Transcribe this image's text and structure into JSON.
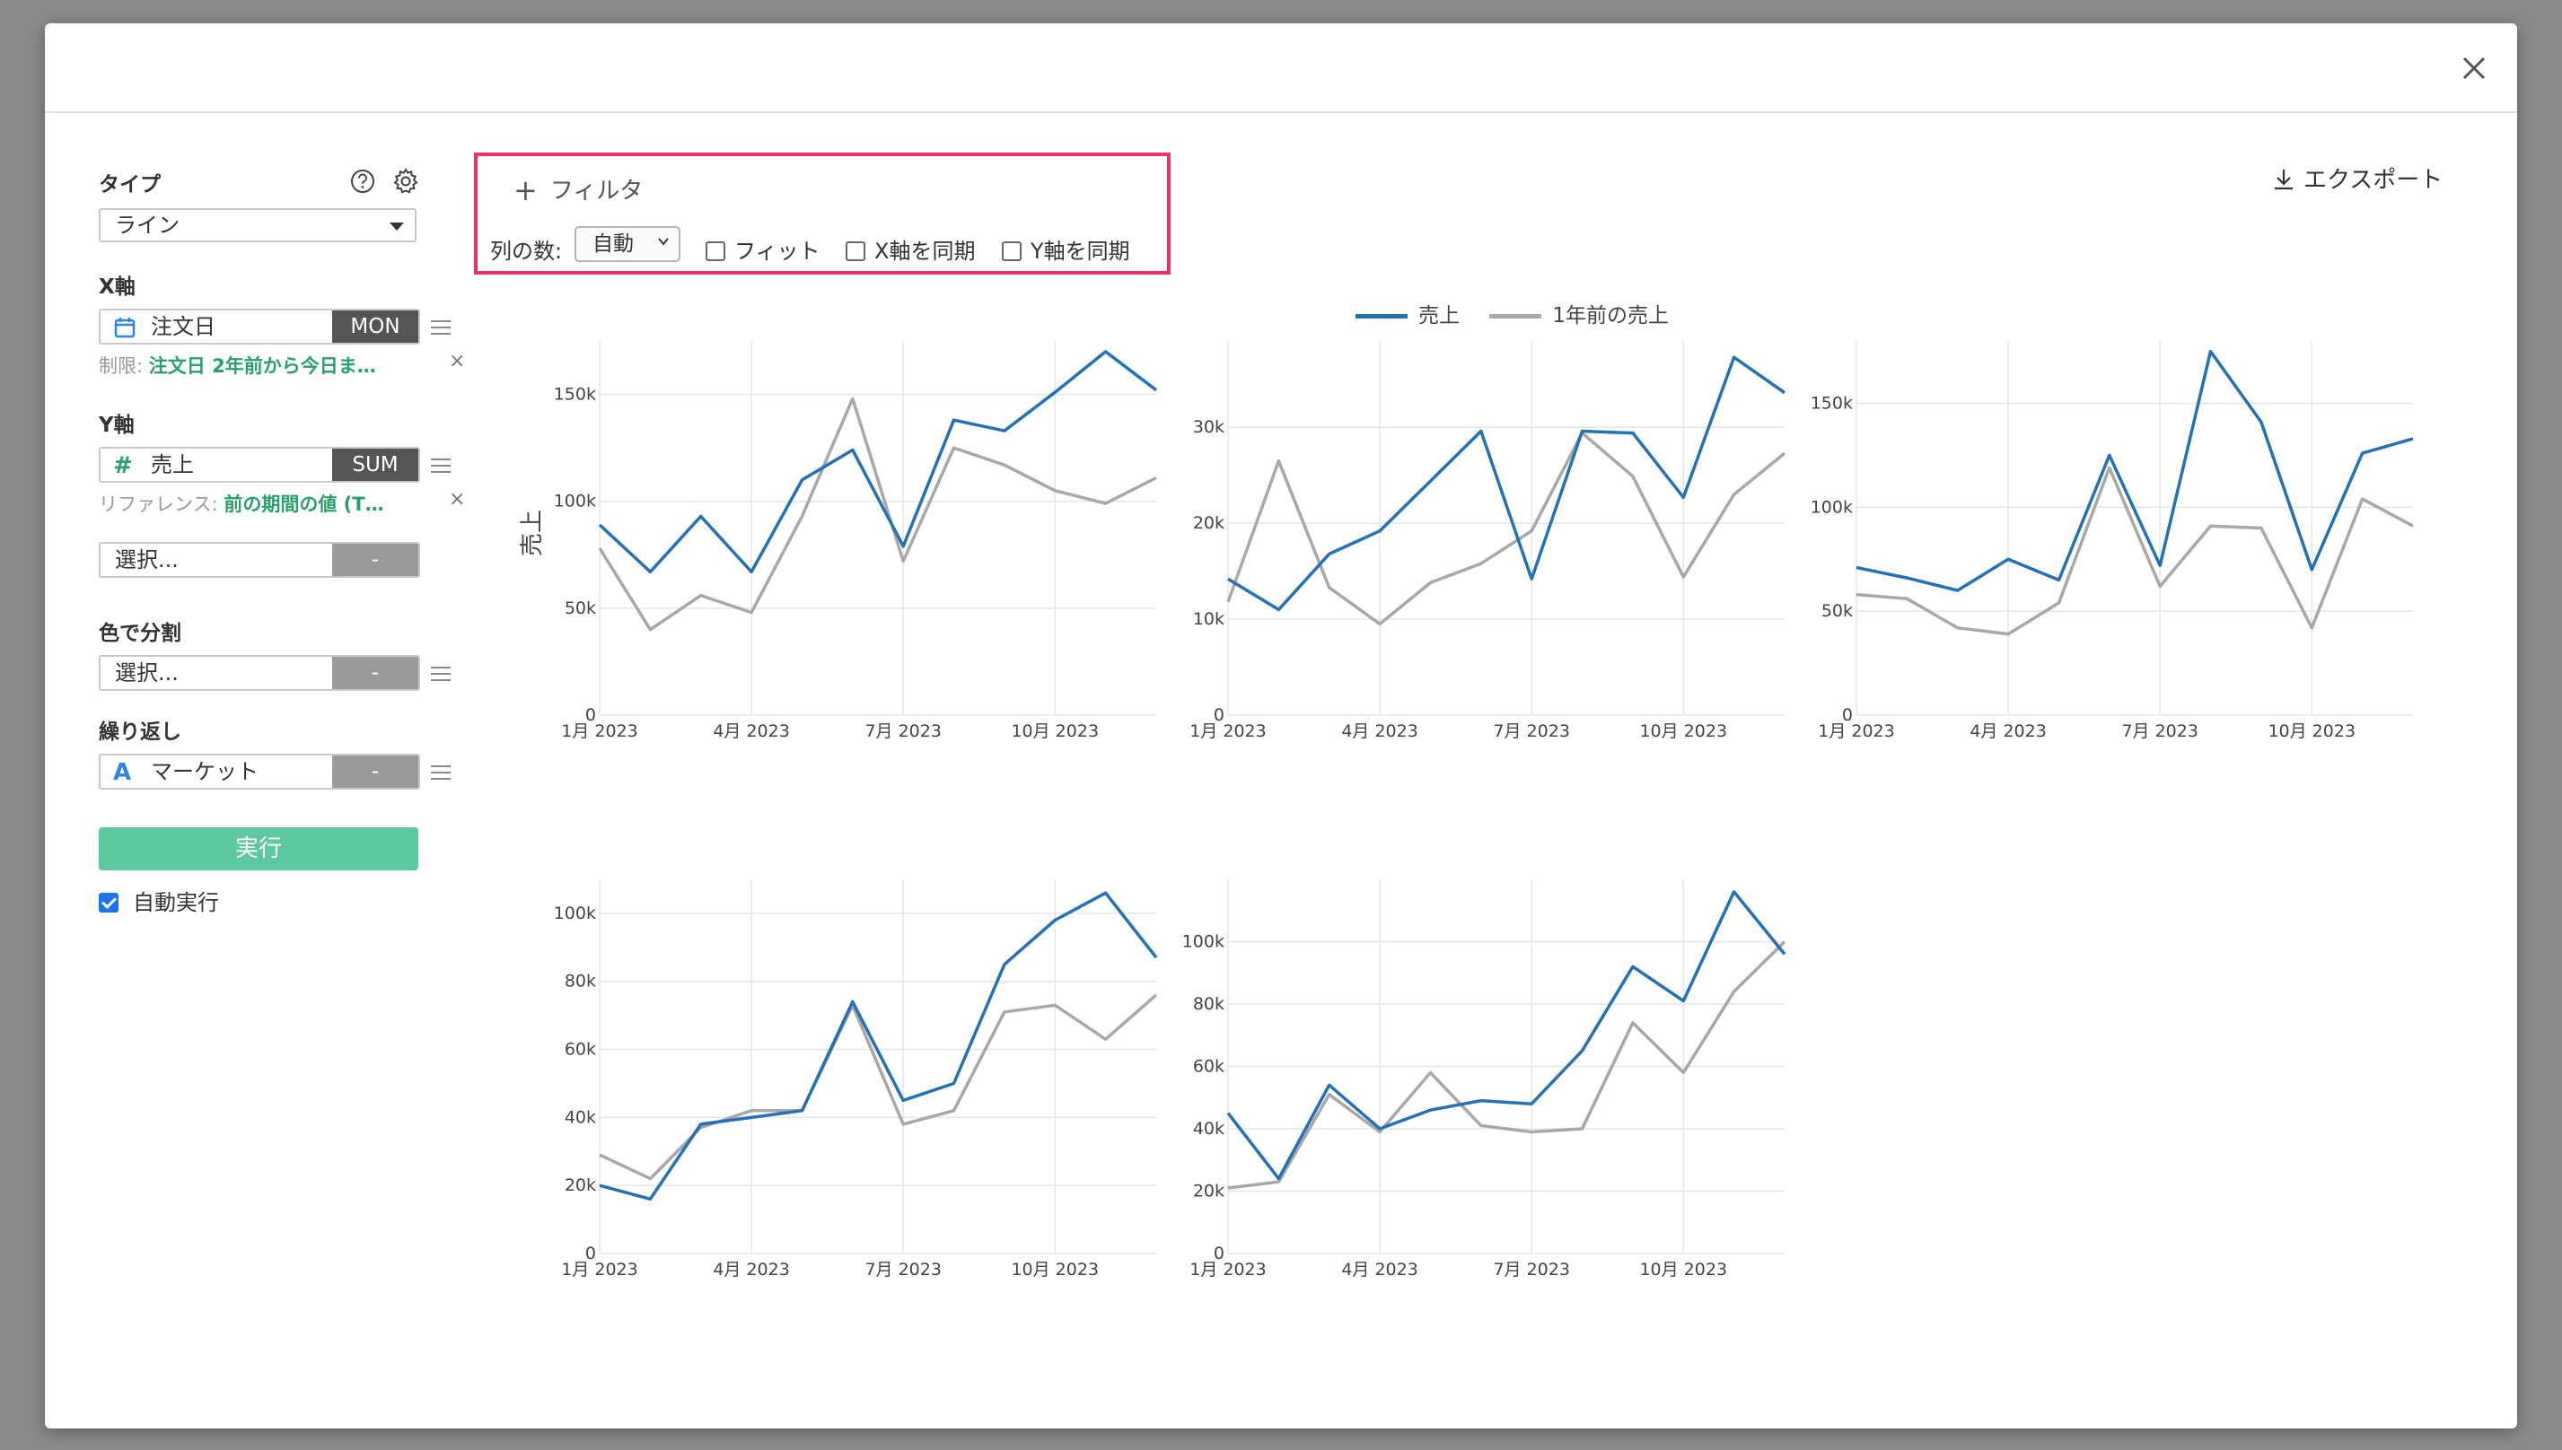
{
  "sidebar": {
    "type_label": "タイプ",
    "type_value": "ライン",
    "x_axis_label": "X軸",
    "x_field": "注文日",
    "x_tag": "MON",
    "x_limit_prefix": "制限:",
    "x_limit_value": "注文日 2年前から今日ま…",
    "y_axis_label": "Y軸",
    "y_field": "売上",
    "y_tag": "SUM",
    "y_ref_prefix": "リファレンス:",
    "y_ref_value": "前の期間の値 (T…",
    "extra_placeholder": "選択...",
    "extra_tag": "-",
    "color_label": "色で分割",
    "color_placeholder": "選択...",
    "color_tag": "-",
    "repeat_label": "繰り返し",
    "repeat_field": "マーケット",
    "repeat_tag": "-",
    "run_label": "実行",
    "auto_run_label": "自動実行",
    "remove_symbol": "×"
  },
  "filter": {
    "add_label": "フィルタ",
    "columns_label": "列の数:",
    "columns_value": "自動",
    "fit_label": "フィット",
    "sync_x_label": "X軸を同期",
    "sync_y_label": "Y軸を同期"
  },
  "export_label": "エクスポート",
  "legend": {
    "series1": "売上",
    "series2": "1年前の売上"
  },
  "y_title": "売上",
  "colors": {
    "series1": "#2471b5",
    "series2": "#a8a8a8",
    "accent": "#e8336d",
    "run": "#5ec8a0"
  },
  "chart_data": [
    {
      "type": "line",
      "x": [
        "1月 2023",
        "2月 2023",
        "3月 2023",
        "4月 2023",
        "5月 2023",
        "6月 2023",
        "7月 2023",
        "8月 2023",
        "9月 2023",
        "10月 2023",
        "11月 2023",
        "12月 2023"
      ],
      "x_tick_labels": [
        "1月 2023",
        "4月 2023",
        "7月 2023",
        "10月 2023"
      ],
      "y_ticks": [
        0,
        50000,
        100000,
        150000
      ],
      "y_tick_labels": [
        "0",
        "50k",
        "100k",
        "150k"
      ],
      "ylim": [
        0,
        175000
      ],
      "ylabel": "売上",
      "series": [
        {
          "name": "売上",
          "values": [
            89000,
            67000,
            93000,
            67000,
            110000,
            124000,
            79000,
            138000,
            133000,
            151000,
            170000,
            152000
          ]
        },
        {
          "name": "1年前の売上",
          "values": [
            78000,
            40000,
            56000,
            48000,
            93000,
            148000,
            72000,
            125000,
            117000,
            105000,
            99000,
            111000
          ]
        }
      ]
    },
    {
      "type": "line",
      "x": [
        "1月 2023",
        "2月 2023",
        "3月 2023",
        "4月 2023",
        "5月 2023",
        "6月 2023",
        "7月 2023",
        "8月 2023",
        "9月 2023",
        "10月 2023",
        "11月 2023",
        "12月 2023"
      ],
      "x_tick_labels": [
        "1月 2023",
        "4月 2023",
        "7月 2023",
        "10月 2023"
      ],
      "y_ticks": [
        0,
        10000,
        20000,
        30000
      ],
      "y_tick_labels": [
        "0",
        "10k",
        "20k",
        "30k"
      ],
      "ylim": [
        0,
        39000
      ],
      "series": [
        {
          "name": "売上",
          "values": [
            14200,
            11000,
            16800,
            19200,
            24400,
            29600,
            14200,
            29600,
            29400,
            22700,
            37300,
            33600
          ]
        },
        {
          "name": "1年前の売上",
          "values": [
            11800,
            26500,
            13300,
            9500,
            13800,
            15800,
            19200,
            29400,
            24900,
            14400,
            23000,
            27300
          ]
        }
      ]
    },
    {
      "type": "line",
      "x": [
        "1月 2023",
        "2月 2023",
        "3月 2023",
        "4月 2023",
        "5月 2023",
        "6月 2023",
        "7月 2023",
        "8月 2023",
        "9月 2023",
        "10月 2023",
        "11月 2023",
        "12月 2023"
      ],
      "x_tick_labels": [
        "1月 2023",
        "4月 2023",
        "7月 2023",
        "10月 2023"
      ],
      "y_ticks": [
        0,
        50000,
        100000,
        150000
      ],
      "y_tick_labels": [
        "0",
        "50k",
        "100k",
        "150k"
      ],
      "ylim": [
        0,
        180000
      ],
      "series": [
        {
          "name": "売上",
          "values": [
            71000,
            66000,
            60000,
            75000,
            65000,
            125000,
            72000,
            175000,
            141000,
            70000,
            126000,
            133000
          ]
        },
        {
          "name": "1年前の売上",
          "values": [
            58000,
            56000,
            42000,
            39000,
            54000,
            119000,
            62000,
            91000,
            90000,
            42000,
            104000,
            91000
          ]
        }
      ]
    },
    {
      "type": "line",
      "x": [
        "1月 2023",
        "2月 2023",
        "3月 2023",
        "4月 2023",
        "5月 2023",
        "6月 2023",
        "7月 2023",
        "8月 2023",
        "9月 2023",
        "10月 2023",
        "11月 2023",
        "12月 2023"
      ],
      "x_tick_labels": [
        "1月 2023",
        "4月 2023",
        "7月 2023",
        "10月 2023"
      ],
      "y_ticks": [
        0,
        20000,
        40000,
        60000,
        80000,
        100000
      ],
      "y_tick_labels": [
        "0",
        "20k",
        "40k",
        "60k",
        "80k",
        "100k"
      ],
      "ylim": [
        0,
        110000
      ],
      "series": [
        {
          "name": "売上",
          "values": [
            20000,
            16000,
            38000,
            40000,
            42000,
            74000,
            45000,
            50000,
            85000,
            98000,
            106000,
            87000
          ]
        },
        {
          "name": "1年前の売上",
          "values": [
            29000,
            22000,
            37000,
            42000,
            42000,
            73000,
            38000,
            42000,
            71000,
            73000,
            63000,
            76000
          ]
        }
      ]
    },
    {
      "type": "line",
      "x": [
        "1月 2023",
        "2月 2023",
        "3月 2023",
        "4月 2023",
        "5月 2023",
        "6月 2023",
        "7月 2023",
        "8月 2023",
        "9月 2023",
        "10月 2023",
        "11月 2023",
        "12月 2023"
      ],
      "x_tick_labels": [
        "1月 2023",
        "4月 2023",
        "7月 2023",
        "10月 2023"
      ],
      "y_ticks": [
        0,
        20000,
        40000,
        60000,
        80000,
        100000
      ],
      "y_tick_labels": [
        "0",
        "20k",
        "40k",
        "60k",
        "80k",
        "100k"
      ],
      "ylim": [
        0,
        120000
      ],
      "series": [
        {
          "name": "売上",
          "values": [
            45000,
            24000,
            54000,
            40000,
            46000,
            49000,
            48000,
            65000,
            92000,
            81000,
            116000,
            96000
          ]
        },
        {
          "name": "1年前の売上",
          "values": [
            21000,
            23000,
            51000,
            39000,
            58000,
            41000,
            39000,
            40000,
            74000,
            58000,
            84000,
            100000
          ]
        }
      ]
    }
  ]
}
